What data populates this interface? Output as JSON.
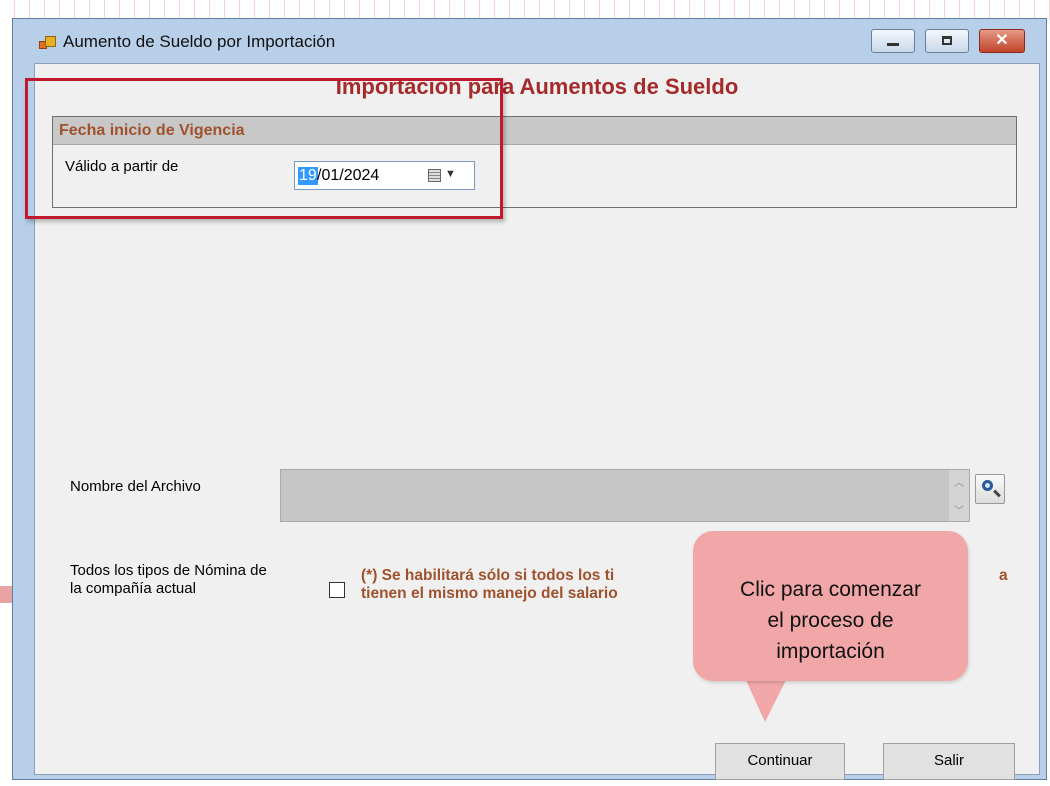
{
  "window": {
    "title": "Aumento de Sueldo por Importación",
    "controls": {
      "minimize": "minimize",
      "maximize": "maximize",
      "close": "close"
    }
  },
  "form": {
    "title": "Importación para Aumentos de Sueldo",
    "group": {
      "title": "Fecha inicio de Vigencia",
      "valid_from_label": "Válido a partir de",
      "date_day": "19",
      "date_rest": "/01/2024"
    },
    "file_label": "Nombre del Archivo",
    "payroll_label_line1": "Todos los tipos de Nómina de",
    "payroll_label_line2": "la compañía actual",
    "note_line1": "(*) Se habilitará sólo si todos los ti",
    "note_line2": "tienen el mismo manejo del salario",
    "note_tail": "a",
    "continue_button": "Continuar",
    "exit_button": "Salir"
  },
  "callout": {
    "line1": "Clic para comenzar",
    "line2": "el proceso de",
    "line3": "importación"
  },
  "colors": {
    "title_red": "#a52a2a",
    "group_brown": "#a0522d",
    "highlight_red": "#c0192d",
    "callout_pink": "#f1a7a7"
  }
}
